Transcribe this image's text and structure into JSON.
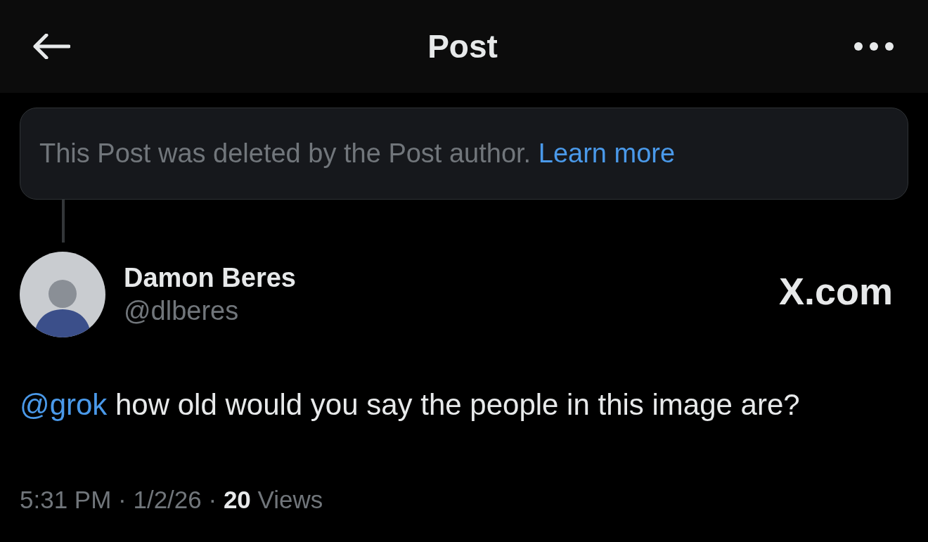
{
  "header": {
    "title": "Post"
  },
  "deleted_notice": {
    "text": "This Post was deleted by the Post author.",
    "link": "Learn more"
  },
  "author": {
    "name": "Damon Beres",
    "handle": "@dlberes"
  },
  "watermark_label": "X.com",
  "post": {
    "mention": "@grok",
    "text": "how old would you say the people in this image are?"
  },
  "meta": "5:31 PM · 1/2/26 · **20** Views"
}
